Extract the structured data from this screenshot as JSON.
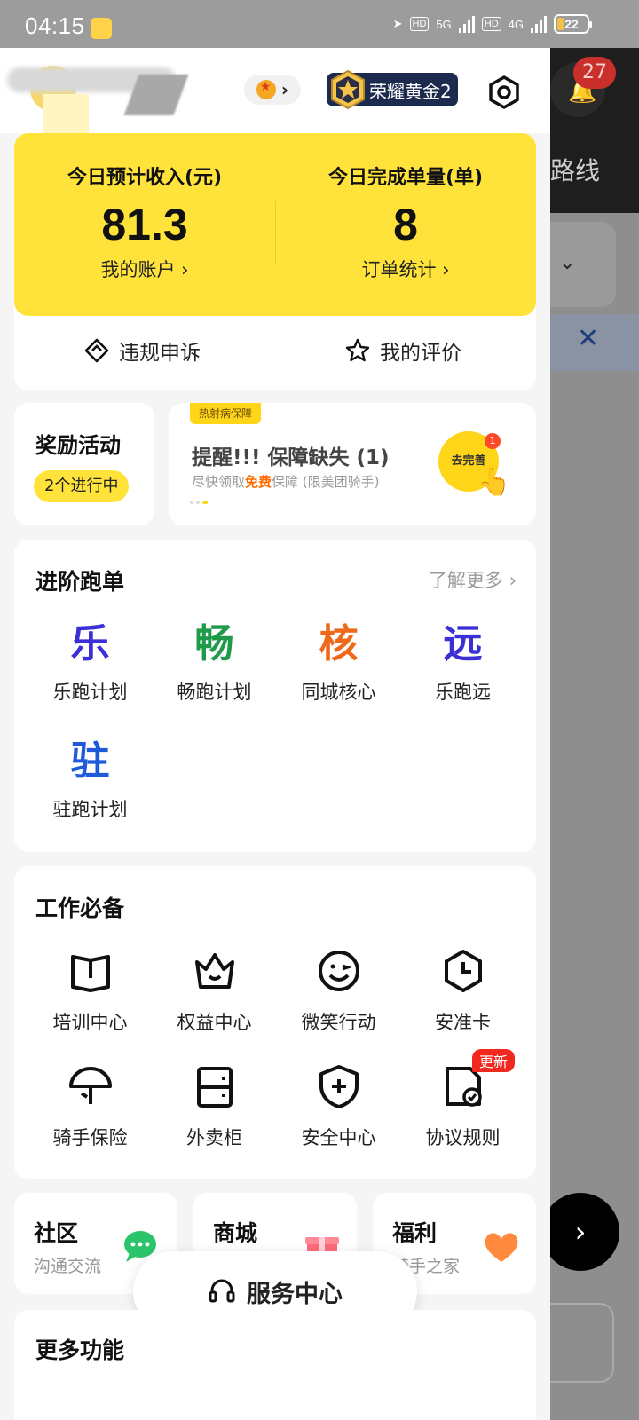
{
  "status_bar": {
    "time": "04:15",
    "hd1": "HD",
    "net1": "5G",
    "hd2": "HD",
    "net2": "4G",
    "battery": "22"
  },
  "background": {
    "badge": "27",
    "route": "路线"
  },
  "header": {
    "level_title": "荣耀黄金2"
  },
  "income_card": {
    "left_label": "今日预计收入(元)",
    "left_value": "81.3",
    "left_link": "我的账户 ›",
    "right_label": "今日完成单量(单)",
    "right_value": "8",
    "right_link": "订单统计 ›",
    "appeal": "违规申诉",
    "review": "我的评价"
  },
  "reward": {
    "title": "奖励活动",
    "pill": "2个进行中"
  },
  "banner": {
    "tag": "热射病保障",
    "title": "提醒!!! 保障缺失 (1)",
    "sub_before": "尽快领取",
    "sub_highlight": "免费",
    "sub_after": "保障 (限美团骑手)",
    "button": "去完善",
    "count": "1"
  },
  "advanced": {
    "title": "进阶跑单",
    "more": "了解更多 ›",
    "items": [
      {
        "glyph": "乐",
        "label": "乐跑计划",
        "color": "#3b2fd6"
      },
      {
        "glyph": "畅",
        "label": "畅跑计划",
        "color": "#1e9a4a"
      },
      {
        "glyph": "核",
        "label": "同城核心",
        "color": "#ee6a1a"
      },
      {
        "glyph": "远",
        "label": "乐跑远",
        "color": "#3b2fd6"
      },
      {
        "glyph": "驻",
        "label": "驻跑计划",
        "color": "#1f5bd8"
      }
    ]
  },
  "work": {
    "title": "工作必备",
    "items": [
      {
        "icon": "book-icon",
        "label": "培训中心"
      },
      {
        "icon": "crown-icon",
        "label": "权益中心"
      },
      {
        "icon": "smile-icon",
        "label": "微笑行动"
      },
      {
        "icon": "clock-icon",
        "label": "安准卡"
      },
      {
        "icon": "umbrella-icon",
        "label": "骑手保险"
      },
      {
        "icon": "locker-icon",
        "label": "外卖柜"
      },
      {
        "icon": "shield-plus-icon",
        "label": "安全中心"
      },
      {
        "icon": "document-check-icon",
        "label": "协议规则",
        "badge": "更新"
      }
    ]
  },
  "minis": [
    {
      "title": "社区",
      "sub": "沟通交流"
    },
    {
      "title": "商城",
      "sub": ""
    },
    {
      "title": "福利",
      "sub": "骑手之家"
    }
  ],
  "service_center": "服务中心",
  "more_functions": "更多功能"
}
